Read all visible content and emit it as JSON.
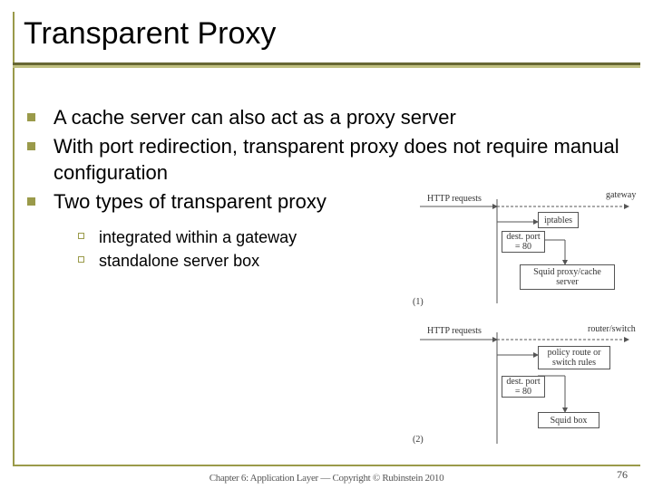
{
  "title": "Transparent Proxy",
  "bullets": {
    "b1": "A cache server can also act as a proxy server",
    "b2": "With port redirection, transparent proxy does not require manual configuration",
    "b3": "Two types of transparent proxy",
    "s1": "integrated within a gateway",
    "s2": "standalone server box"
  },
  "diagram": {
    "http_requests_1": "HTTP\nrequests",
    "gateway": "gateway",
    "iptables": "iptables",
    "dest_port_1": "dest. port\n= 80",
    "squid_proxy": "Squid proxy/cache\nserver",
    "marker_1": "(1)",
    "http_requests_2": "HTTP\nrequests",
    "router_switch": "router/switch",
    "policy_route": "policy route or\nswitch rules",
    "dest_port_2": "dest. port\n= 80",
    "squid_box": "Squid box",
    "marker_2": "(2)"
  },
  "footer": {
    "center": "Chapter 6: Application Layer — Copyright © Rubinstein 2010",
    "page": "76"
  }
}
